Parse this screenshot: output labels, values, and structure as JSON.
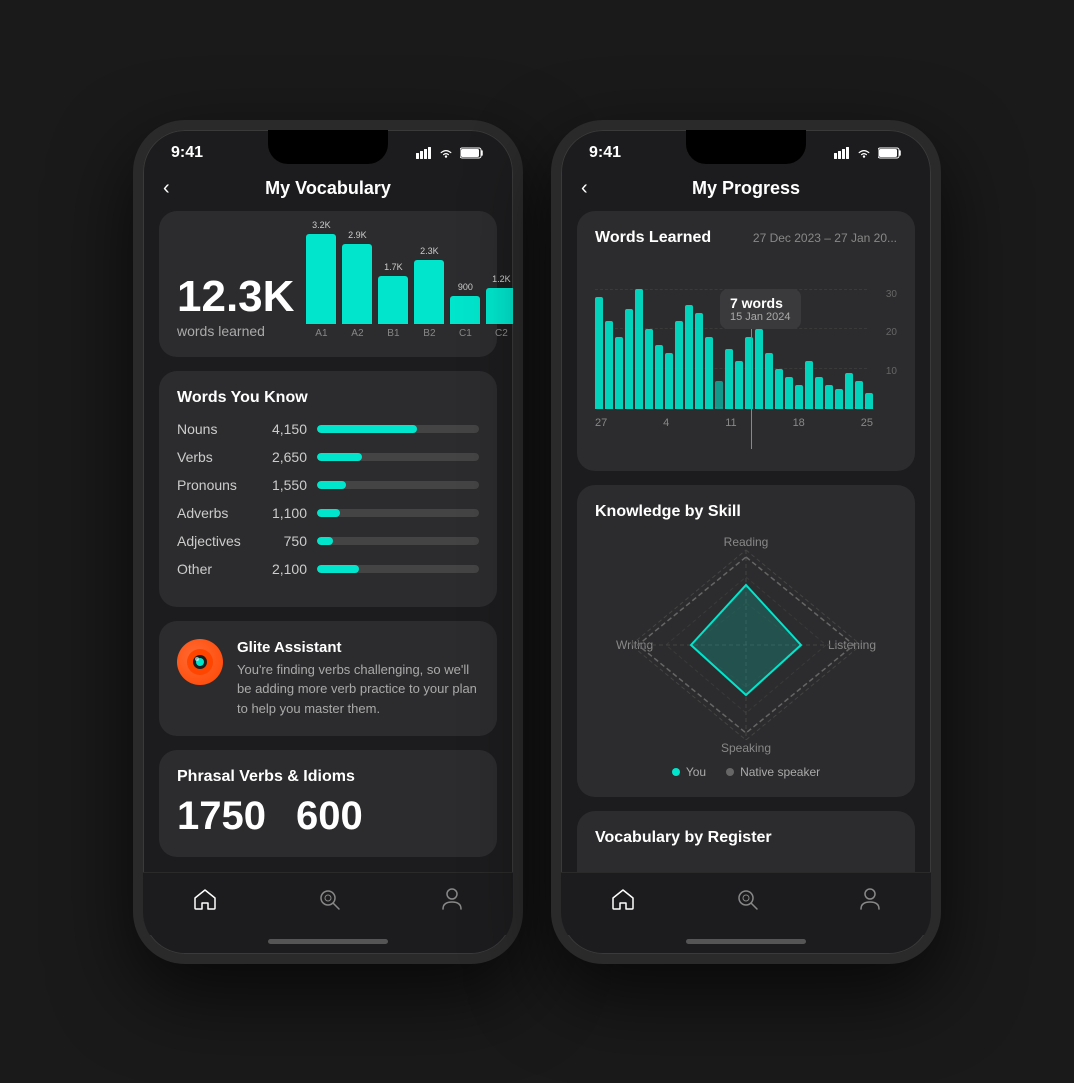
{
  "left_phone": {
    "status_time": "9:41",
    "title": "My Vocabulary",
    "total_words": "12.3K",
    "words_label": "words learned",
    "bar_chart": {
      "bars": [
        {
          "label": "A1",
          "value": "3.2K",
          "height": 90
        },
        {
          "label": "A2",
          "value": "2.9K",
          "height": 80
        },
        {
          "label": "B1",
          "value": "1.7K",
          "height": 48
        },
        {
          "label": "B2",
          "value": "2.3K",
          "height": 64
        },
        {
          "label": "C1",
          "value": "900",
          "height": 28
        },
        {
          "label": "C2",
          "value": "1.2K",
          "height": 36
        }
      ]
    },
    "words_you_know": {
      "title": "Words You Know",
      "items": [
        {
          "name": "Nouns",
          "count": "4,150",
          "percent": 62
        },
        {
          "name": "Verbs",
          "count": "2,650",
          "percent": 28
        },
        {
          "name": "Pronouns",
          "count": "1,550",
          "percent": 18
        },
        {
          "name": "Adverbs",
          "count": "1,100",
          "percent": 14
        },
        {
          "name": "Adjectives",
          "count": "750",
          "percent": 10
        },
        {
          "name": "Other",
          "count": "2,100",
          "percent": 26
        }
      ]
    },
    "assistant": {
      "name": "Glite Assistant",
      "text": "You're finding verbs challenging, so we'll be adding more verb practice to your plan to help you master them."
    },
    "phrasal": {
      "title": "Phrasal Verbs & Idioms",
      "number1": "1750",
      "number2": "600"
    },
    "nav": {
      "items": [
        {
          "icon": "🏠",
          "label": "",
          "active": true
        },
        {
          "icon": "🔍",
          "label": "",
          "active": false
        },
        {
          "icon": "👤",
          "label": "",
          "active": false
        }
      ]
    }
  },
  "right_phone": {
    "status_time": "9:41",
    "title": "My Progress",
    "words_learned": {
      "section_title": "Words Learned",
      "date_range": "27 Dec 2023 – 27 Jan 20...",
      "tooltip_words": "7 words",
      "tooltip_date": "15 Jan 2024",
      "bars": [
        28,
        22,
        18,
        25,
        30,
        20,
        16,
        14,
        22,
        26,
        24,
        18,
        7,
        15,
        12,
        18,
        20,
        14,
        10,
        8,
        6,
        12,
        8,
        6,
        5,
        9,
        7,
        4
      ],
      "x_labels": [
        "27",
        "4",
        "11",
        "18",
        "25"
      ],
      "y_labels": [
        "30",
        "20",
        "10"
      ]
    },
    "knowledge_by_skill": {
      "title": "Knowledge by Skill",
      "labels": {
        "top": "Reading",
        "bottom": "Speaking",
        "left": "Writing",
        "right": "Listening"
      },
      "legend": [
        {
          "label": "You",
          "color": "#00e5cc"
        },
        {
          "label": "Native speaker",
          "color": "#666"
        }
      ]
    },
    "vocabulary_by_register": {
      "title": "Vocabulary by Register"
    },
    "nav": {
      "items": [
        {
          "icon": "🏠",
          "active": true
        },
        {
          "icon": "🔍",
          "active": false
        },
        {
          "icon": "👤",
          "active": false
        }
      ]
    }
  },
  "colors": {
    "accent": "#00e5cc",
    "bg_card": "#2c2c2e",
    "bg_phone": "#1c1c1e",
    "text_primary": "#ffffff",
    "text_secondary": "#aaaaaa"
  }
}
